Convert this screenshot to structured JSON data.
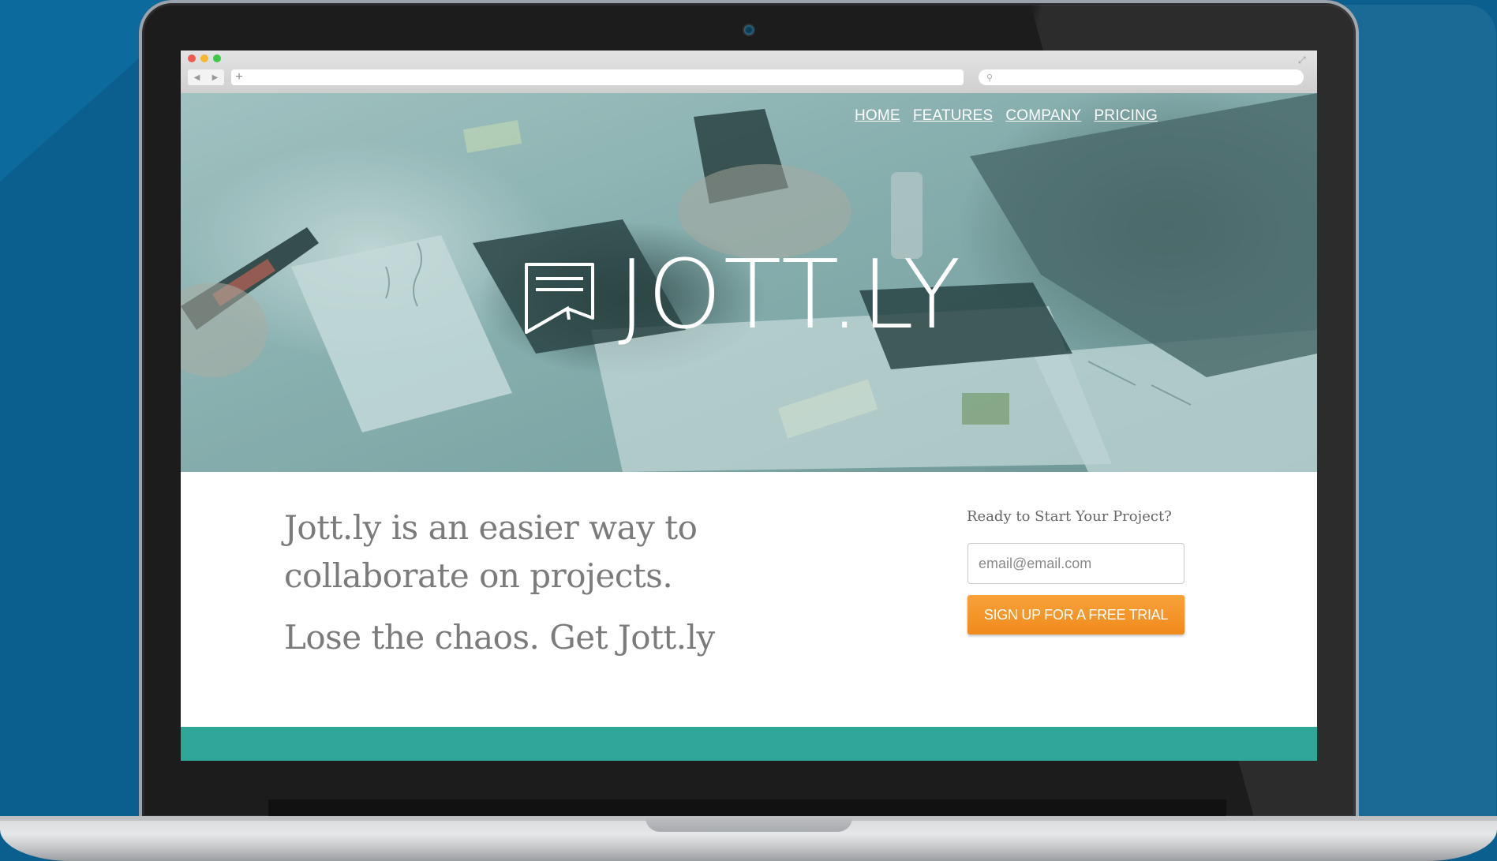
{
  "browser": {
    "search_glyph": "⚲",
    "back_glyph": "◀",
    "forward_glyph": "▶",
    "new_tab_glyph": "+",
    "expand_glyph": "⤢"
  },
  "nav": {
    "items": [
      {
        "label": "HOME"
      },
      {
        "label": "FEATURES"
      },
      {
        "label": "COMPANY"
      },
      {
        "label": "PRICING"
      }
    ]
  },
  "brand": {
    "name": "JOTT.LY",
    "icon": "note-logo-icon"
  },
  "content": {
    "tagline": "Jott.ly is an easier way to collaborate on projects.",
    "slogan": "Lose the chaos. Get Jott.ly"
  },
  "cta": {
    "title": "Ready to Start Your Project?",
    "email_placeholder": "email@email.com",
    "button_label": "SIGN UP FOR A FREE TRIAL"
  },
  "colors": {
    "background": "#0a5f8e",
    "accent_orange": "#f39223",
    "footer_teal": "#2ea698",
    "text_gray": "#7b7b7b"
  }
}
